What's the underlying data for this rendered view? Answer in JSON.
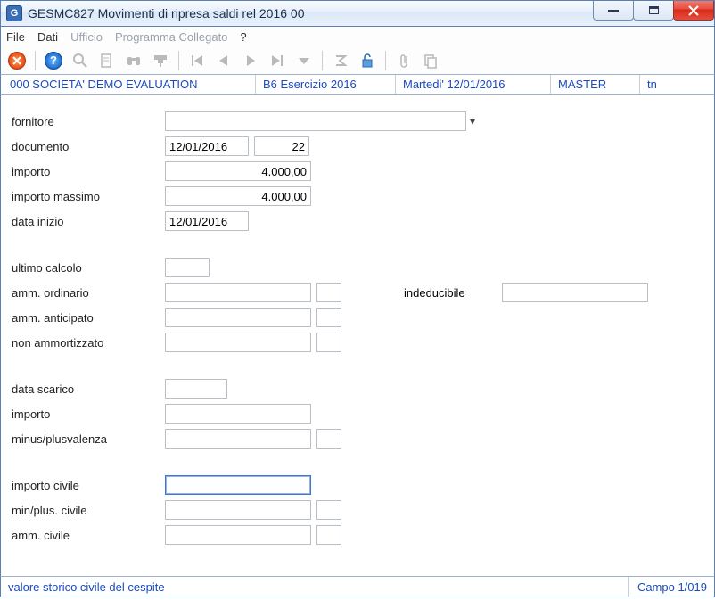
{
  "window": {
    "icon": "G",
    "title": "GESMC827  Movimenti di ripresa saldi rel 2016 00"
  },
  "menu": {
    "file": "File",
    "dati": "Dati",
    "ufficio": "Ufficio",
    "programma": "Programma Collegato",
    "help": "?"
  },
  "info": {
    "company": "000 SOCIETA'  DEMO EVALUATION",
    "exercise": "B6 Esercizio 2016",
    "date": "Martedi'  12/01/2016",
    "user": "MASTER",
    "term": "tn"
  },
  "labels": {
    "fornitore": "fornitore",
    "documento": "documento",
    "importo": "importo",
    "importo_massimo": "importo massimo",
    "data_inizio": "data inizio",
    "ultimo_calcolo": "ultimo calcolo",
    "amm_ordinario": "amm. ordinario",
    "amm_anticipato": "amm. anticipato",
    "non_ammortizzato": "non ammortizzato",
    "indeducibile": "indeducibile",
    "data_scarico": "data scarico",
    "importo2": "importo",
    "minus_plus": "minus/plusvalenza",
    "importo_civile": "importo civile",
    "min_plus_civile": "min/plus. civile",
    "amm_civile": "amm. civile"
  },
  "values": {
    "fornitore": "",
    "doc_date": "12/01/2016",
    "doc_num": "22",
    "importo": "4.000,00",
    "importo_massimo": "4.000,00",
    "data_inizio": "12/01/2016",
    "ultimo_calcolo": "",
    "amm_ordinario": "",
    "amm_ordinario_b": "",
    "indeducibile": "",
    "amm_anticipato": "",
    "amm_anticipato_b": "",
    "non_ammortizzato": "",
    "non_ammortizzato_b": "",
    "data_scarico": "",
    "importo2": "",
    "minus_plus": "",
    "minus_plus_b": "",
    "importo_civile": "",
    "min_plus_civile": "",
    "min_plus_civile_b": "",
    "amm_civile": "",
    "amm_civile_b": ""
  },
  "status": {
    "hint": "valore storico civile del cespite",
    "campo": "Campo  1/019"
  }
}
